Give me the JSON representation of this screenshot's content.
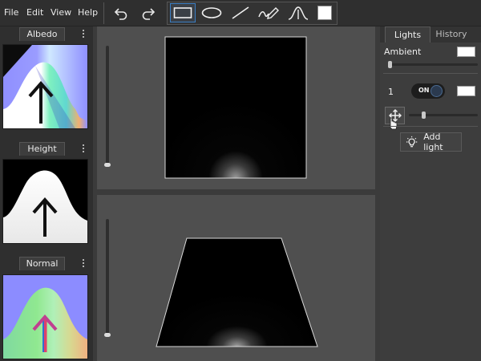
{
  "menu": {
    "file": "File",
    "edit": "Edit",
    "view": "View",
    "help": "Help"
  },
  "toolbar": {
    "tools": [
      "undo",
      "redo",
      "rectangle",
      "ellipse",
      "line",
      "freehand",
      "curve",
      "color"
    ],
    "active_tool": "rectangle",
    "current_color": "#ffffff"
  },
  "textures": {
    "albedo": "Albedo",
    "height": "Height",
    "normal": "Normal"
  },
  "viewports": {
    "top_slider_level": 0.0,
    "bottom_slider_level": 0.0
  },
  "lights_panel": {
    "tab_lights": "Lights",
    "tab_history": "History",
    "ambient_label": "Ambient",
    "ambient_level": 0.0,
    "ambient_color": "#ffffff",
    "light_index": "1",
    "toggle_label": "ON",
    "light_color": "#ffffff",
    "light_intensity": 0.2,
    "add_light": "Add light"
  }
}
